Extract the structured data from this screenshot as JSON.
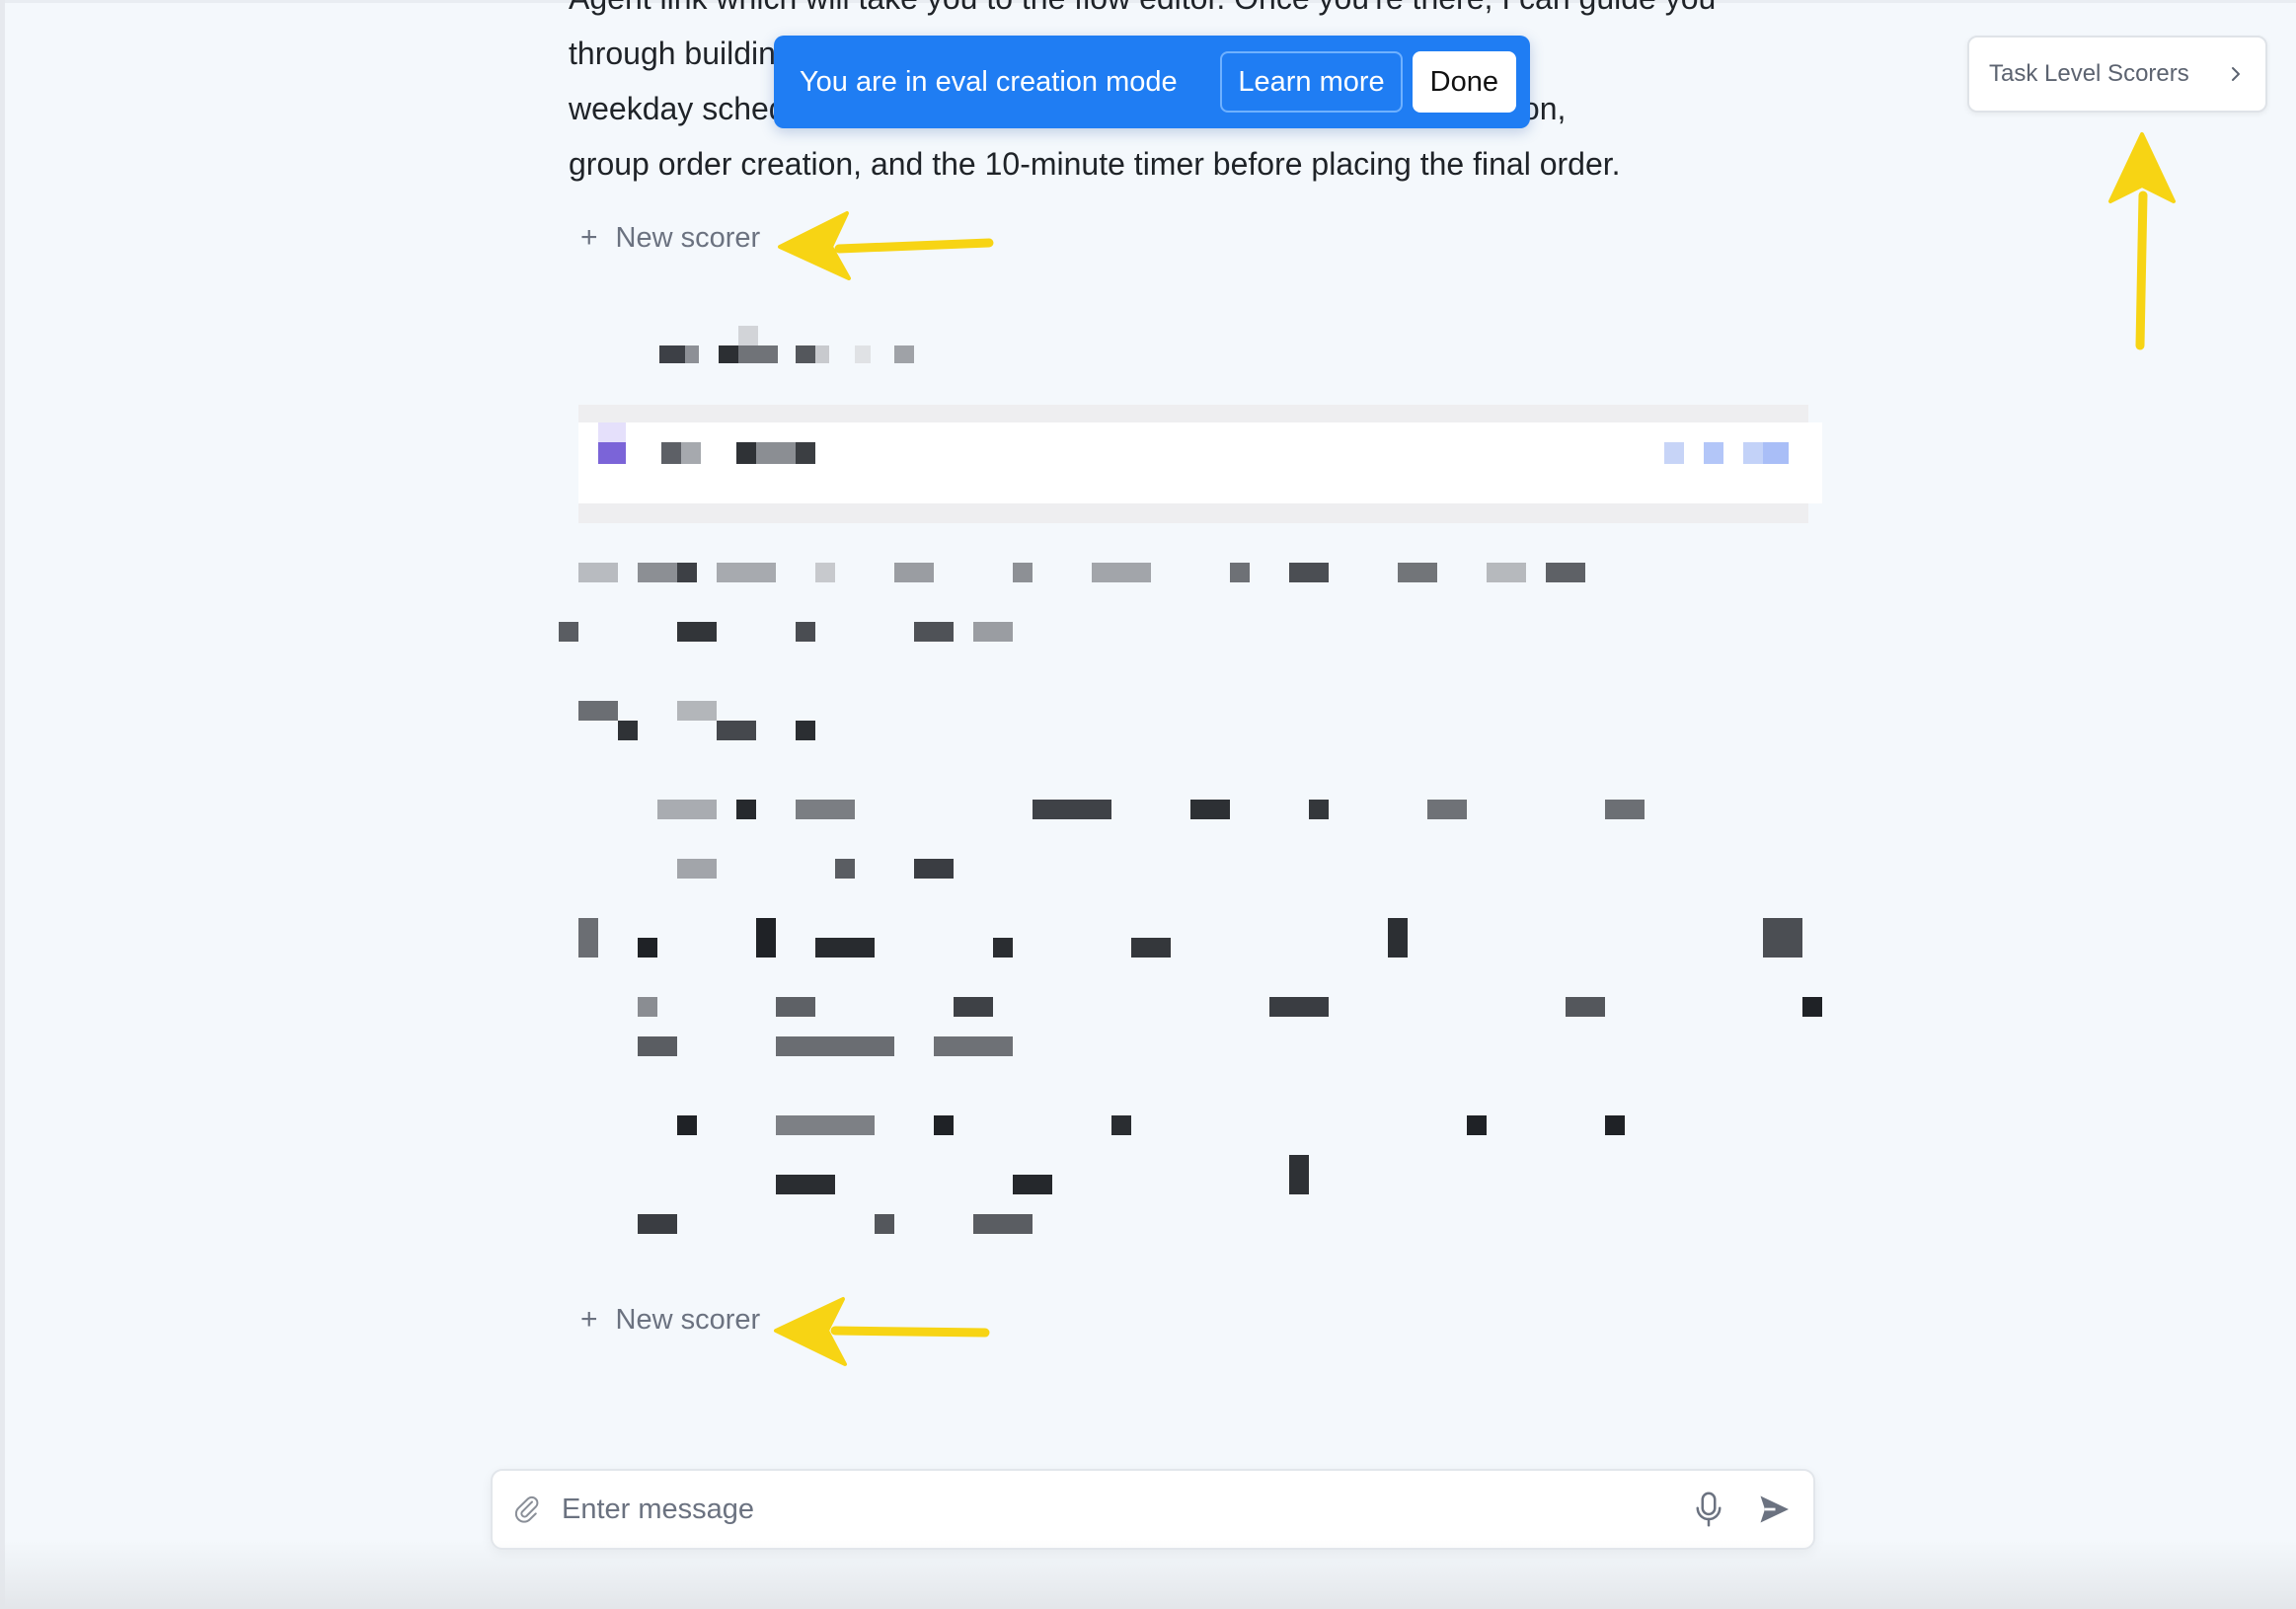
{
  "message": {
    "lines": [
      "Agent link which will take you to the flow editor. Once you're there, I can guide you",
      "through building each component - from the",
      "weekday schedule trigger, through the Slack and DoorDash integration,",
      "group order creation, and the 10-minute timer before placing the final order."
    ]
  },
  "eval_banner": {
    "text": "You are in eval creation mode",
    "learn_more": "Learn more",
    "done": "Done"
  },
  "task_scorers": {
    "label": "Task Level Scorers",
    "icon": "chevron-right-icon"
  },
  "new_scorer": {
    "label": "New scorer",
    "icon": "plus-icon"
  },
  "composer": {
    "placeholder": "Enter message",
    "attach_icon": "paperclip-icon",
    "mic_icon": "microphone-icon",
    "send_icon": "send-icon"
  },
  "annotation_color": "#f7d414",
  "accent": "#1f7df3"
}
